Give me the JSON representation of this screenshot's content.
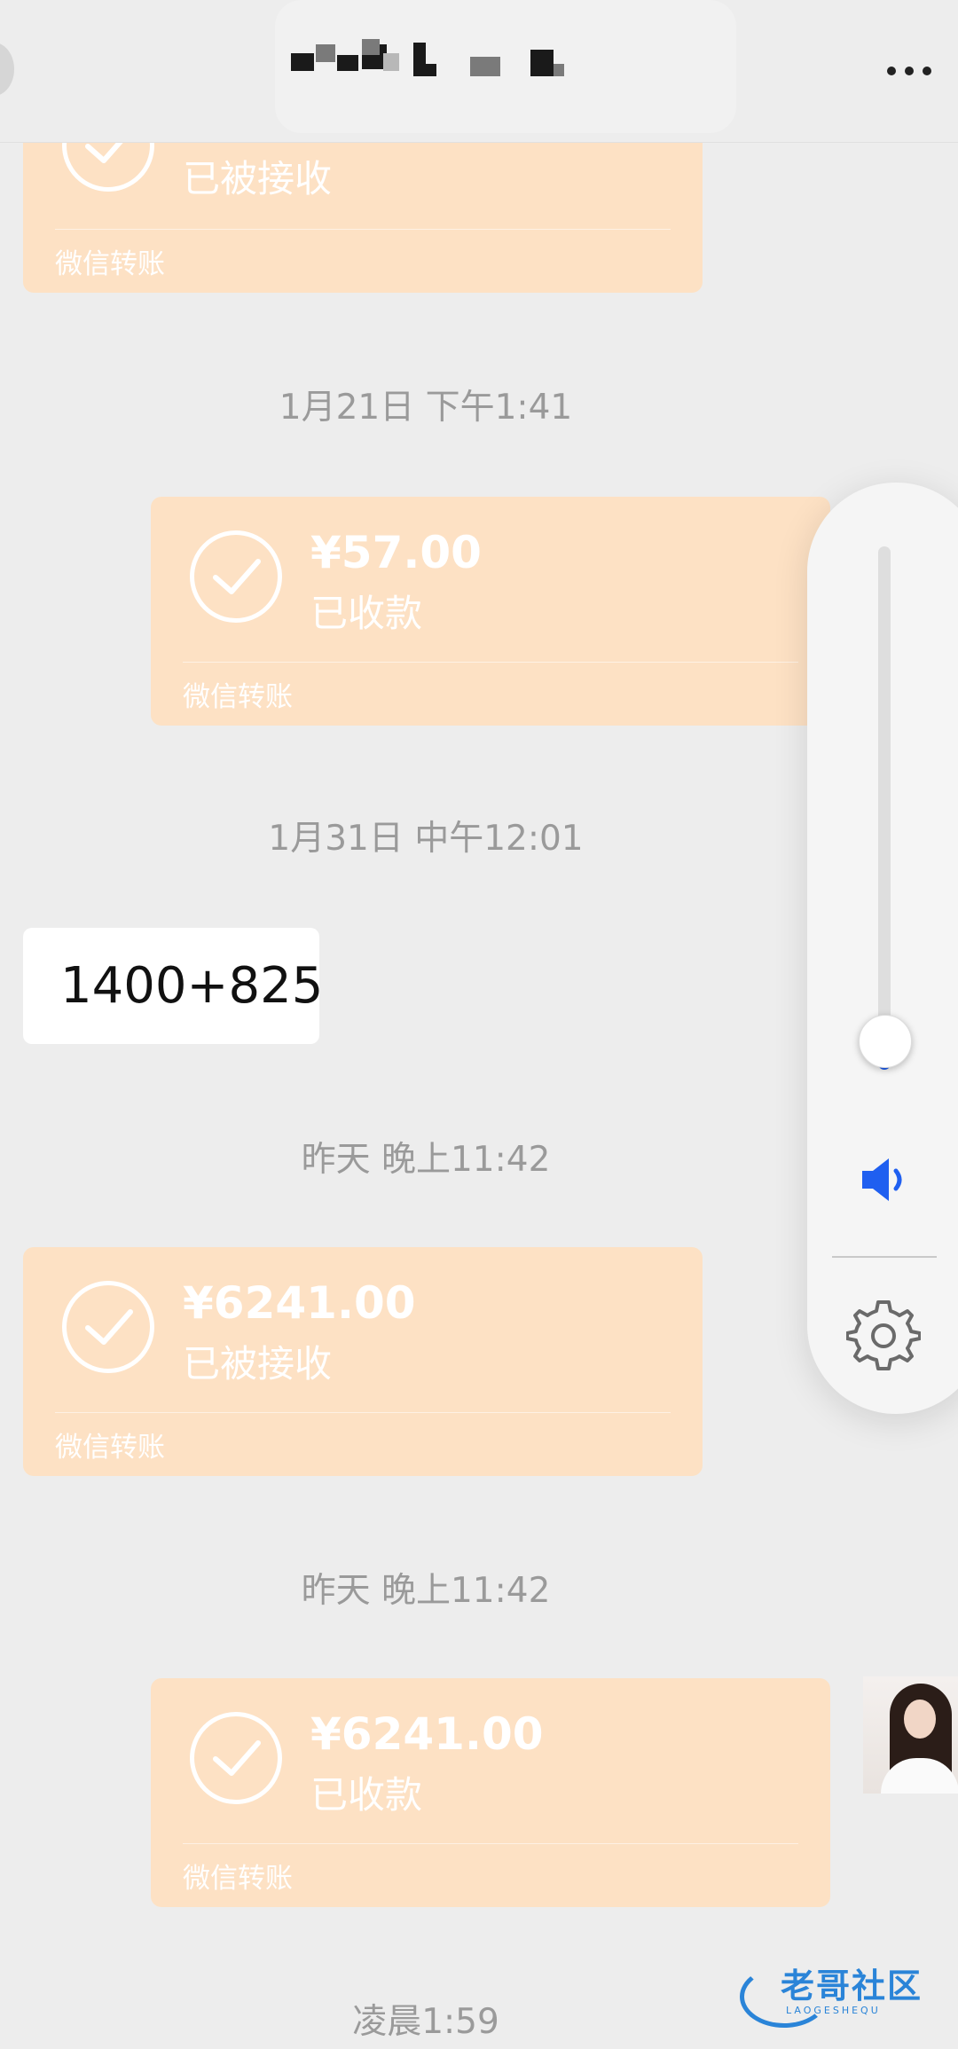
{
  "header": {
    "more_icon": "more-horizontal-icon"
  },
  "messages": [
    {
      "type": "transfer",
      "side": "left",
      "status": "已被接收",
      "footer": "微信转账"
    },
    {
      "type": "timestamp",
      "text": "1月21日 下午1:41"
    },
    {
      "type": "transfer",
      "side": "right",
      "amount": "¥57.00",
      "status": "已收款",
      "footer": "微信转账"
    },
    {
      "type": "timestamp",
      "text": "1月31日 中午12:01"
    },
    {
      "type": "text",
      "side": "left",
      "text": "1400+825"
    },
    {
      "type": "timestamp",
      "text": "昨天 晚上11:42"
    },
    {
      "type": "transfer",
      "side": "left",
      "amount": "¥6241.00",
      "status": "已被接收",
      "footer": "微信转账"
    },
    {
      "type": "timestamp",
      "text": "昨天 晚上11:42"
    },
    {
      "type": "transfer",
      "side": "right",
      "amount": "¥6241.00",
      "status": "已收款",
      "footer": "微信转账"
    },
    {
      "type": "timestamp",
      "text": "凌晨1:59"
    }
  ],
  "volume_panel": {
    "level_percent": 6,
    "speaker_icon": "speaker-icon",
    "settings_icon": "gear-icon",
    "accent_color": "#1f5ff0"
  },
  "watermark": {
    "text": "老哥社区",
    "subtext": "LAOGESHEQU"
  },
  "colors": {
    "transfer_bg": "#fde1c4",
    "chat_bg": "#ededed",
    "timestamp": "#9a9a9a"
  }
}
